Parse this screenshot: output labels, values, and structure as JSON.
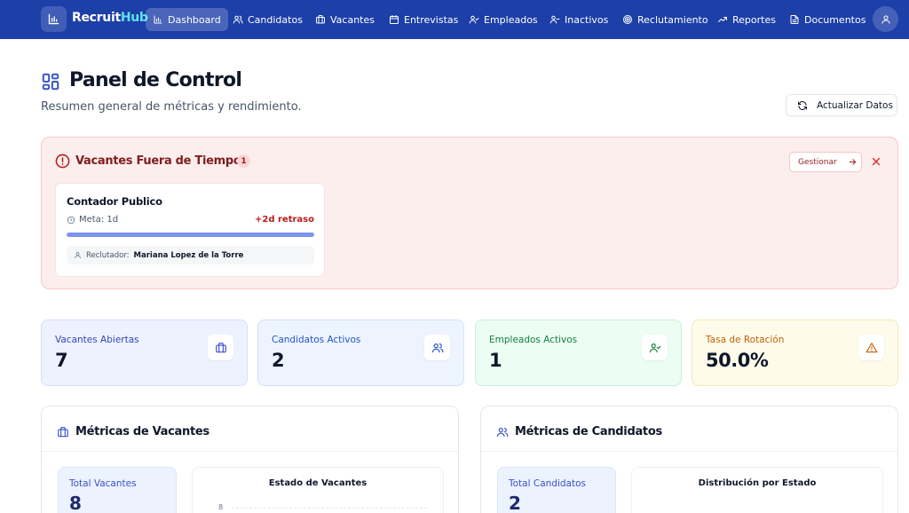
{
  "brand": {
    "name_part1": "Recruit",
    "name_part2": "Hub"
  },
  "nav": [
    {
      "label": "Dashboard",
      "icon": "bar-chart-icon",
      "active": true
    },
    {
      "label": "Candidatos",
      "icon": "users-icon"
    },
    {
      "label": "Vacantes",
      "icon": "briefcase-icon"
    },
    {
      "label": "Entrevistas",
      "icon": "calendar-icon"
    },
    {
      "label": "Empleados",
      "icon": "user-check-icon"
    },
    {
      "label": "Inactivos",
      "icon": "user-minus-icon"
    },
    {
      "label": "Reclutamiento",
      "icon": "target-icon"
    },
    {
      "label": "Reportes",
      "icon": "trending-up-icon"
    },
    {
      "label": "Documentos",
      "icon": "file-icon"
    }
  ],
  "header": {
    "title": "Panel de Control",
    "subtitle": "Resumen general de métricas y rendimiento.",
    "refresh_label": "Actualizar Datos"
  },
  "alert": {
    "title": "Vacantes Fuera de Tiempo",
    "count": "1",
    "manage_label": "Gestionar",
    "items": [
      {
        "title": "Contador Publico",
        "meta": "Meta: 1d",
        "delay": "+2d retraso",
        "progress_fraction": 1.0,
        "recruiter_label": "Reclutador:",
        "recruiter_name": "Mariana Lopez de la Torre"
      }
    ]
  },
  "stats": [
    {
      "label": "Vacantes Abiertas",
      "value": "7",
      "icon": "briefcase-icon",
      "bg": "#eef2ff",
      "border": "#d5defc",
      "label_color": "#3146b8",
      "icon_color": "#4051c9"
    },
    {
      "label": "Candidatos Activos",
      "value": "2",
      "icon": "users-icon",
      "bg": "#eef4ff",
      "border": "#d2e0fb",
      "label_color": "#2455c9",
      "icon_color": "#2455c9"
    },
    {
      "label": "Empleados Activos",
      "value": "1",
      "icon": "user-check-icon",
      "bg": "#ecfdf3",
      "border": "#c9f0da",
      "label_color": "#15803d",
      "icon_color": "#15803d"
    },
    {
      "label": "Tasa de Rotación",
      "value": "50.0%",
      "icon": "alert-triangle-icon",
      "bg": "#fefbea",
      "border": "#f6e9b8",
      "label_color": "#c2620b",
      "icon_color": "#c2620b"
    }
  ],
  "panels": {
    "vacantes": {
      "title": "Métricas de Vacantes",
      "total_label": "Total Vacantes",
      "total_value": "8",
      "chart_title": "Estado de Vacantes",
      "chart_tick": "8"
    },
    "candidatos": {
      "title": "Métricas de Candidatos",
      "total_label": "Total Candidatos",
      "total_value": "2",
      "chart_title": "Distribución por Estado"
    }
  },
  "colors": {
    "navbar": "#1d3fa8",
    "accent_cyan": "#5ee3f0",
    "alert_bg": "#fdeeee",
    "alert_text": "#7f1d1d"
  }
}
